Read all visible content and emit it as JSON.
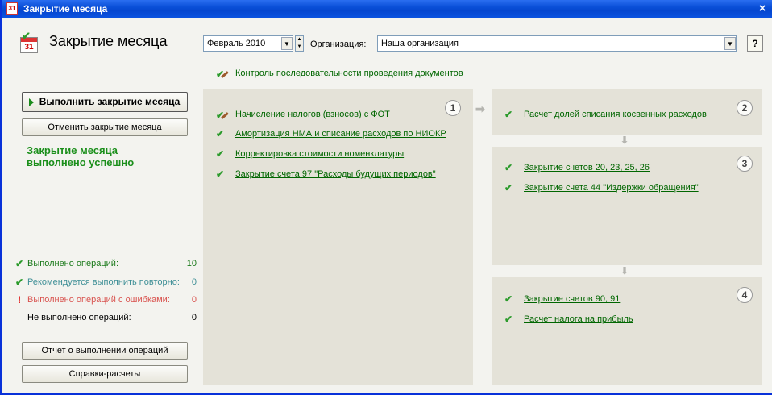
{
  "window": {
    "title": "Закрытие месяца",
    "close_glyph": "×",
    "app_icon_text": "31"
  },
  "header": {
    "title": "Закрытие месяца",
    "calendar_day": "31",
    "period_value": "Февраль 2010",
    "org_label": "Организация:",
    "org_value": "Наша организация",
    "help_label": "?"
  },
  "control_link": "Контроль последовательности проведения документов",
  "left": {
    "run_button": "Выполнить закрытие месяца",
    "cancel_button": "Отменить закрытие месяца",
    "status_line1": "Закрытие месяца",
    "status_line2": "выполнено успешно",
    "stats": [
      {
        "label": "Выполнено операций:",
        "value": "10",
        "icon": "check-icon",
        "color": "#1b7a1b"
      },
      {
        "label": "Рекомендуется выполнить повторно:",
        "value": "0",
        "icon": "check-icon",
        "color": "#3e8f96"
      },
      {
        "label": "Выполнено операций с ошибками:",
        "value": "0",
        "icon": "exclamation-icon",
        "color": "#d9534f"
      },
      {
        "label": "Не выполнено операций:",
        "value": "0",
        "icon": "",
        "color": "#000000"
      }
    ],
    "report_button": "Отчет о выполнении операций",
    "calc_button": "Справки-расчеты"
  },
  "stages": {
    "stage1": {
      "number": "1",
      "tasks": [
        {
          "label": "Начисление налогов (взносов) с ФОТ",
          "icon": "pencil-check-icon"
        },
        {
          "label": "Амортизация НМА и списание расходов по НИОКР",
          "icon": "check-icon"
        },
        {
          "label": "Корректировка стоимости номенклатуры",
          "icon": "check-icon"
        },
        {
          "label": "Закрытие счета 97 \"Расходы будущих периодов\"",
          "icon": "check-icon"
        }
      ]
    },
    "stage2": {
      "number": "2",
      "tasks": [
        {
          "label": "Расчет долей списания косвенных расходов",
          "icon": "check-icon"
        }
      ]
    },
    "stage3": {
      "number": "3",
      "tasks": [
        {
          "label": "Закрытие счетов 20, 23, 25, 26",
          "icon": "check-icon"
        },
        {
          "label": "Закрытие счета 44 \"Издержки обращения\"",
          "icon": "check-icon"
        }
      ]
    },
    "stage4": {
      "number": "4",
      "tasks": [
        {
          "label": "Закрытие счетов 90, 91",
          "icon": "check-icon"
        },
        {
          "label": "Расчет налога на прибыль",
          "icon": "check-icon"
        }
      ]
    }
  },
  "glyphs": {
    "check": "✔",
    "exclamation": "!",
    "dropdown": "▼",
    "spin_up": "▲",
    "spin_down": "▼",
    "arrow_right": "➡",
    "arrow_down": "⬇"
  }
}
